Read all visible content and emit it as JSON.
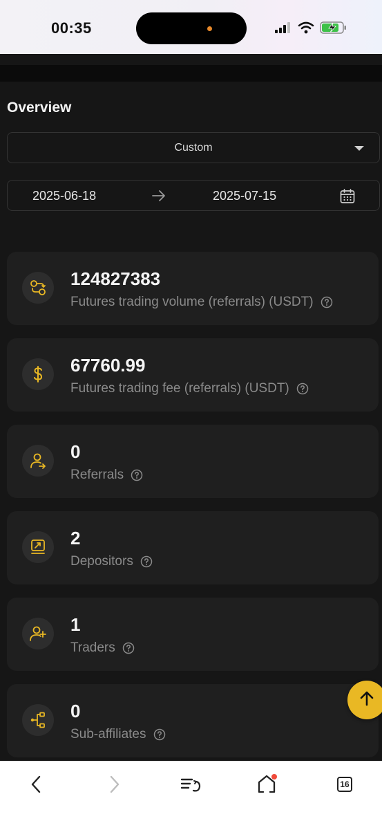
{
  "status_bar": {
    "time": "00:35"
  },
  "overview": {
    "title": "Overview",
    "period_select": {
      "value": "Custom"
    },
    "date_range": {
      "start": "2025-06-18",
      "end": "2025-07-15"
    }
  },
  "cards": [
    {
      "value": "124827383",
      "label": "Futures trading volume (referrals) (USDT)",
      "icon": "exchange-icon"
    },
    {
      "value": "67760.99",
      "label": "Futures trading fee (referrals) (USDT)",
      "icon": "dollar-icon"
    },
    {
      "value": "0",
      "label": "Referrals",
      "icon": "user-referral-icon"
    },
    {
      "value": "2",
      "label": "Depositors",
      "icon": "deposit-icon"
    },
    {
      "value": "1",
      "label": "Traders",
      "icon": "user-add-icon"
    },
    {
      "value": "0",
      "label": "Sub-affiliates",
      "icon": "hierarchy-icon"
    }
  ],
  "browser_toolbar": {
    "tab_count": "16"
  },
  "colors": {
    "accent": "#e9b824",
    "background": "#161616",
    "card": "#1f1f1f"
  }
}
